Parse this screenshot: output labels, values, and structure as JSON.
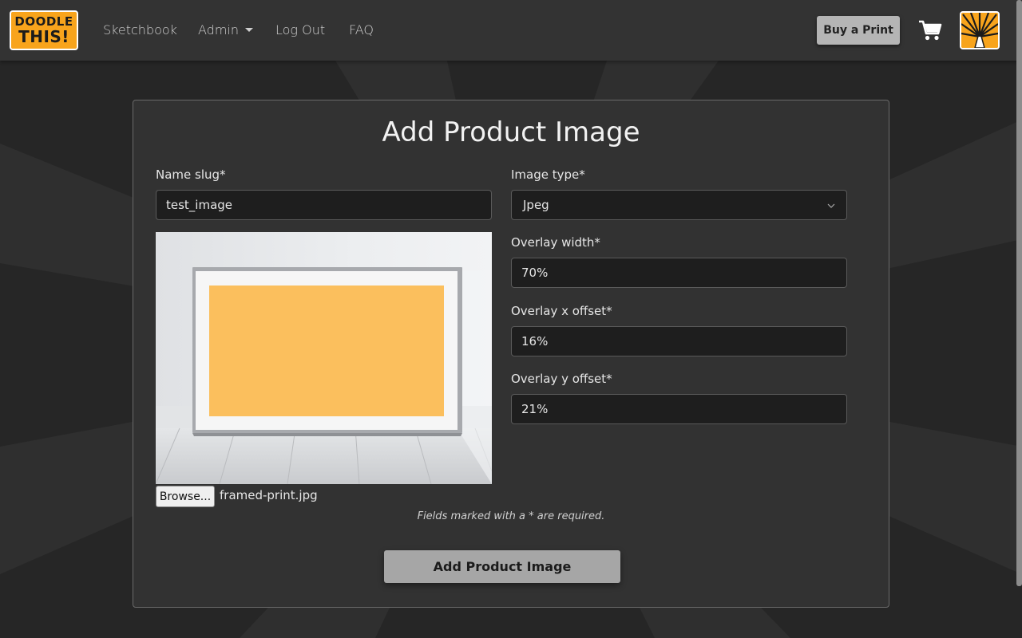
{
  "brand": {
    "line1": "DOODLE",
    "line2": "THIS!"
  },
  "nav": {
    "sketchbook": "Sketchbook",
    "admin": "Admin",
    "logout": "Log Out",
    "faq": "FAQ",
    "buy_print": "Buy a Print"
  },
  "icons": {
    "cart": "shopping-cart-icon",
    "avatar": "sunburst-pencil-logo",
    "select": "chevron-down-icon"
  },
  "form": {
    "title": "Add Product Image",
    "name_slug": {
      "label": "Name slug*",
      "value": "test_image"
    },
    "image_type": {
      "label": "Image type*",
      "value": "Jpeg"
    },
    "overlay_width": {
      "label": "Overlay width*",
      "value": "70%"
    },
    "overlay_x": {
      "label": "Overlay x offset*",
      "value": "16%"
    },
    "overlay_y": {
      "label": "Overlay y offset*",
      "value": "21%"
    },
    "browse_label": "Browse...",
    "file_name": "framed-print.jpg",
    "required_note": "Fields marked with a * are required.",
    "submit_label": "Add Product Image"
  },
  "colors": {
    "accent": "#f8a41c",
    "overlay": "#fbbf5d",
    "background": "#262626",
    "navbar": "#333333"
  }
}
